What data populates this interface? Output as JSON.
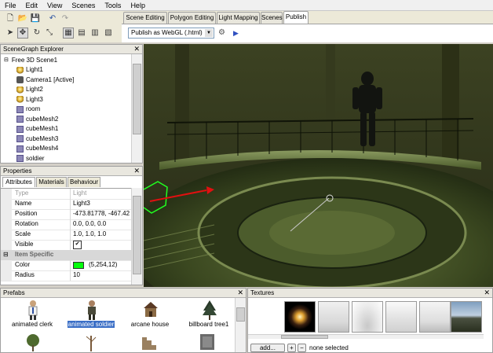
{
  "menu": [
    "File",
    "Edit",
    "View",
    "Scenes",
    "Tools",
    "Help"
  ],
  "tabs": [
    "Scene Editing",
    "Polygon Editing",
    "Light Mapping",
    "Scenes",
    "Publish"
  ],
  "publish": {
    "target": "Publish as WebGL (.html)",
    "settings_icon": "gear-icon",
    "run_icon": "play-icon"
  },
  "scenegraph": {
    "title": "SceneGraph Explorer",
    "root": "Free 3D Scene1",
    "items": [
      {
        "label": "Light1",
        "icon": "light-icon"
      },
      {
        "label": "Camera1 [Active]",
        "icon": "camera-icon"
      },
      {
        "label": "Light2",
        "icon": "light-icon"
      },
      {
        "label": "Light3",
        "icon": "light-icon"
      },
      {
        "label": "room",
        "icon": "mesh-icon"
      },
      {
        "label": "cubeMesh2",
        "icon": "mesh-icon"
      },
      {
        "label": "cubeMesh1",
        "icon": "mesh-icon"
      },
      {
        "label": "cubeMesh3",
        "icon": "mesh-icon"
      },
      {
        "label": "cubeMesh4",
        "icon": "mesh-icon"
      },
      {
        "label": "soldier",
        "icon": "mesh-icon"
      }
    ]
  },
  "properties": {
    "title": "Properties",
    "tabs": [
      "Attributes",
      "Materials",
      "Behaviour"
    ],
    "rows": [
      {
        "key": "Type",
        "value": "Light",
        "dim": true
      },
      {
        "key": "Name",
        "value": "Light3"
      },
      {
        "key": "Position",
        "value": "-473.81778, -467.42"
      },
      {
        "key": "Rotation",
        "value": "0.0, 0.0, 0.0"
      },
      {
        "key": "Scale",
        "value": "1.0, 1.0, 1.0"
      },
      {
        "key": "Visible",
        "value": "✔"
      }
    ],
    "section": "Item Specific",
    "color_label": "Color",
    "color_value": "(5,254,12)",
    "color_hex": "#05fe0c",
    "radius_label": "Radius",
    "radius_value": "10"
  },
  "prefabs": {
    "title": "Prefabs",
    "items": [
      "animated clerk",
      "animated soldier",
      "arcane house",
      "billboard tree1"
    ],
    "selected": "animated soldier"
  },
  "textures": {
    "title": "Textures",
    "add_label": "add...",
    "status": "none selected"
  }
}
